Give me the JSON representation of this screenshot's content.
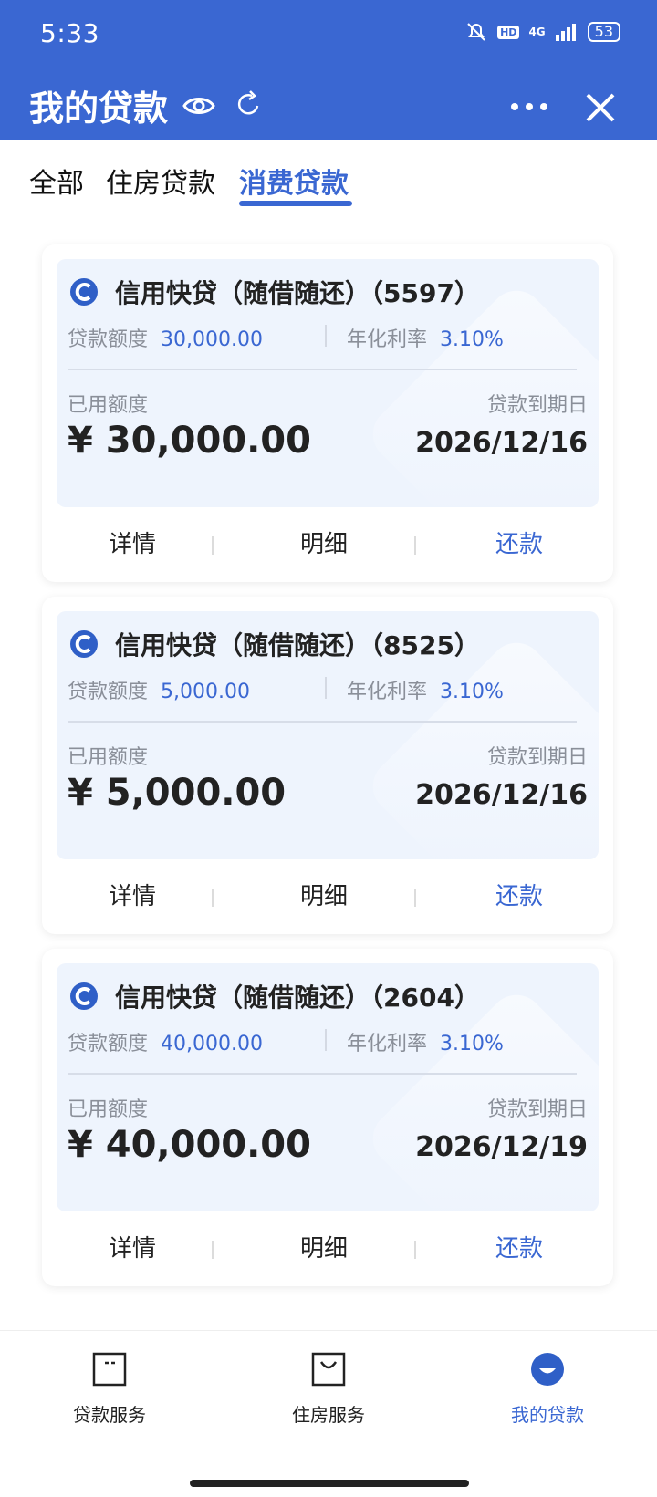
{
  "status_bar": {
    "time": "5:33",
    "hd": "HD",
    "network": "4G",
    "battery": "53"
  },
  "header": {
    "title": "我的贷款"
  },
  "tabs": [
    {
      "label": "全部",
      "active": false
    },
    {
      "label": "住房贷款",
      "active": false
    },
    {
      "label": "消费贷款",
      "active": true
    }
  ],
  "loans": [
    {
      "title": "信用快贷（随借随还）（5597）",
      "amount_label": "贷款额度",
      "amount": "30,000.00",
      "rate_label": "年化利率",
      "rate": "3.10%",
      "used_label": "已用额度",
      "used": "¥ 30,000.00",
      "due_label": "贷款到期日",
      "due": "2026/12/16",
      "actions": [
        "详情",
        "明细",
        "还款"
      ]
    },
    {
      "title": "信用快贷（随借随还）（8525）",
      "amount_label": "贷款额度",
      "amount": "5,000.00",
      "rate_label": "年化利率",
      "rate": "3.10%",
      "used_label": "已用额度",
      "used": "¥ 5,000.00",
      "due_label": "贷款到期日",
      "due": "2026/12/16",
      "actions": [
        "详情",
        "明细",
        "还款"
      ]
    },
    {
      "title": "信用快贷（随借随还）（2604）",
      "amount_label": "贷款额度",
      "amount": "40,000.00",
      "rate_label": "年化利率",
      "rate": "3.10%",
      "used_label": "已用额度",
      "used": "¥ 40,000.00",
      "due_label": "贷款到期日",
      "due": "2026/12/19",
      "actions": [
        "详情",
        "明细",
        "还款"
      ]
    }
  ],
  "bottom_nav": [
    {
      "label": "贷款服务",
      "icon": "loan-service-icon",
      "active": false
    },
    {
      "label": "住房服务",
      "icon": "housing-service-icon",
      "active": false
    },
    {
      "label": "我的贷款",
      "icon": "my-loans-icon",
      "active": true
    }
  ],
  "colors": {
    "primary": "#3a67d2",
    "card_bg": "#eef4fd",
    "muted": "#8a8f99"
  }
}
